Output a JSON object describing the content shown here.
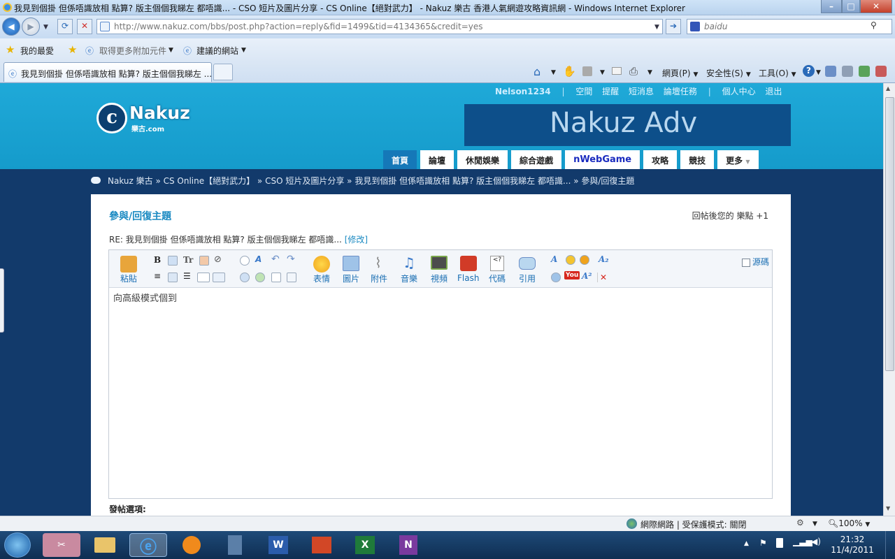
{
  "window": {
    "title": "我見到個掛 但係唔識放相 點算? 版主個個我睇左 都唔識... - CSO 短片及圖片分享 - CS Online【絕對武力】 - Nakuz 樂古 香港人氣網遊攻略資訊網 - Windows Internet Explorer",
    "min": "–",
    "max": "□",
    "close": "✕"
  },
  "address": {
    "url": "http://www.nakuz.com/bbs/post.php?action=reply&fid=1499&tid=4134365&credit=yes"
  },
  "search": {
    "placeholder": "baidu"
  },
  "favorites": {
    "label": "我的最愛",
    "addons": "取得更多附加元件",
    "suggested": "建議的網站"
  },
  "tab": {
    "title": "我見到個掛 但係唔識放相 點算? 版主個個我睇左 ..."
  },
  "commands": {
    "page": "網頁(P)",
    "safety": "安全性(S)",
    "tools": "工具(O)"
  },
  "site": {
    "logo": "Nakuz",
    "logo_sub": "樂古.com",
    "adv": "Nakuz Adv",
    "userbar": {
      "user": "Nelson1234",
      "links": [
        "空間",
        "提醒",
        "短消息",
        "論壇任務",
        "個人中心",
        "退出"
      ]
    },
    "nav": [
      "首頁",
      "論壇",
      "休閒娛樂",
      "綜合遊戲",
      "nWebGame",
      "攻略",
      "競技",
      "更多"
    ],
    "nav_active": 0,
    "breadcrumb": "Nakuz 樂古 » CS Online【絕對武力】 » CSO 短片及圖片分享 » 我見到個掛 但係唔識放相 點算? 版主個個我睇左 都唔識... » 參與/回復主題"
  },
  "post": {
    "title": "參與/回復主題",
    "credit": "回帖後您的 樂點 +1",
    "subject": "RE: 我見到個掛 但係唔識放相 點算? 版主個個我睇左 都唔識...",
    "edit_link": "修改",
    "toolbar": {
      "paste": "粘貼",
      "items": [
        "表情",
        "圖片",
        "附件",
        "音樂",
        "視頻",
        "Flash",
        "代碼",
        "引用"
      ],
      "source": "源碼"
    },
    "body_text": "向高級模式個到",
    "options_label": "發帖選項:"
  },
  "statusbar": {
    "zone": "網際網路 | 受保護模式: 關閉",
    "zoom": "100%"
  },
  "clock": {
    "time": "21:32",
    "date": "11/4/2011"
  },
  "colors": {
    "header": "#1fa9d8",
    "page_bg": "#123a6b",
    "link": "#1b8ac2",
    "nav_active": "#1578b8"
  }
}
